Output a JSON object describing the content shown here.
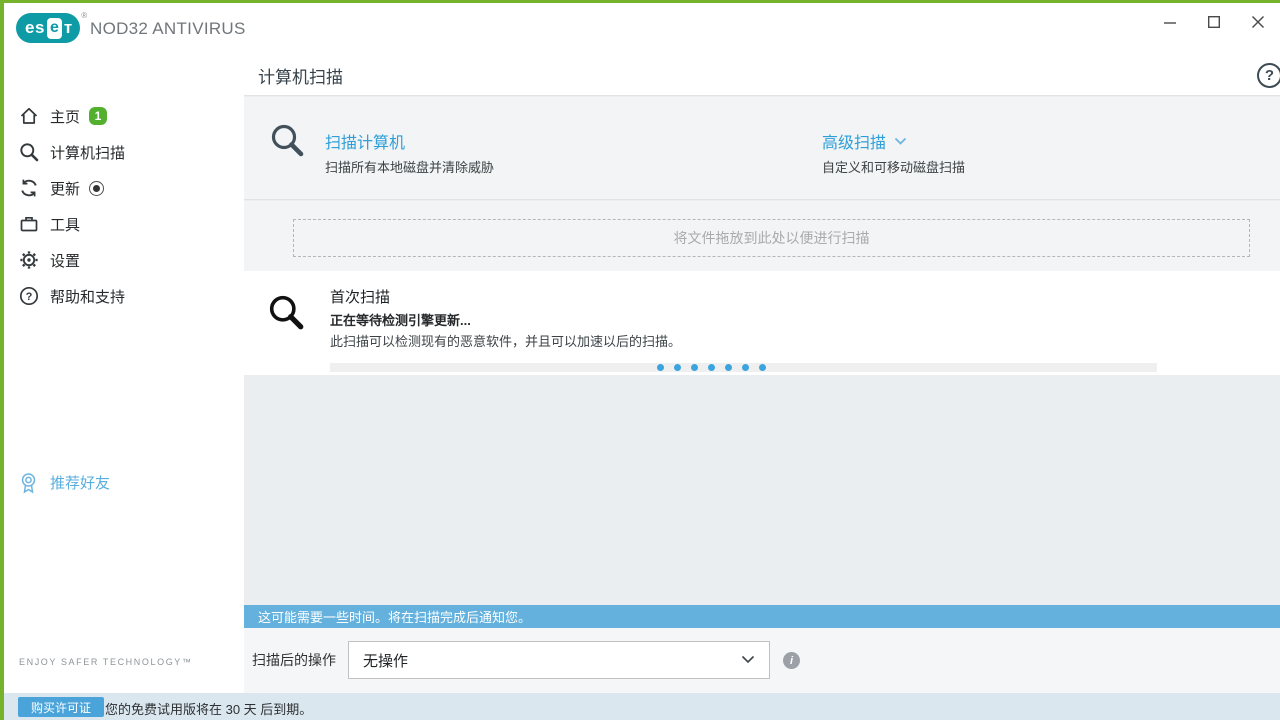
{
  "titlebar": {
    "brand_letters": [
      "es",
      "e",
      "т"
    ],
    "registered": "®",
    "product": "NOD32 ANTIVIRUS"
  },
  "sidebar": {
    "items": [
      {
        "label": "主页",
        "badge": "1"
      },
      {
        "label": "计算机扫描"
      },
      {
        "label": "更新"
      },
      {
        "label": "工具"
      },
      {
        "label": "设置"
      },
      {
        "label": "帮助和支持"
      }
    ],
    "refer_label": "推荐好友",
    "tagline": "ENJOY SAFER TECHNOLOGY™"
  },
  "header": {
    "title": "计算机扫描",
    "help_glyph": "?"
  },
  "scan_options": {
    "primary_title": "扫描计算机",
    "primary_subtitle": "扫描所有本地磁盘并清除威胁",
    "advanced_title": "高级扫描",
    "advanced_subtitle": "自定义和可移动磁盘扫描"
  },
  "dropzone_text": "将文件拖放到此处以便进行扫描",
  "first_scan": {
    "title": "首次扫描",
    "status": "正在等待检测引擎更新...",
    "description": "此扫描可以检测现有的恶意软件，并且可以加速以后的扫描。"
  },
  "notification_text": "这可能需要一些时间。将在扫描完成后通知您。",
  "post_scan": {
    "label": "扫描后的操作",
    "selected_option": "无操作",
    "info_glyph": "i"
  },
  "footer": {
    "buy_button": "购买许可证",
    "trial_notice": "您的免费试用版将在 30 天 后到期。"
  },
  "colors": {
    "accent_green": "#76b32d",
    "badge_green": "#53b02e",
    "brand_teal": "#0e9ba6",
    "link_blue": "#2e9fd9",
    "notify_blue": "#64b1dd",
    "buy_blue": "#4aa4da"
  }
}
